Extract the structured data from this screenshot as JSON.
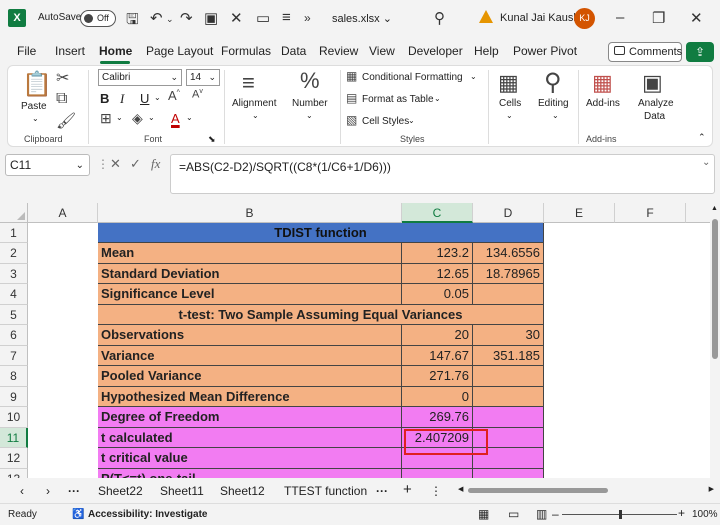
{
  "app": {
    "logo": "X",
    "autosave_label": "AutoSave",
    "autosave_state": "Off",
    "filename": "sales.xlsx",
    "filename_chevron": "⌄",
    "user_name": "Kunal Jai Kaushik",
    "user_initials": "KJ",
    "icons": [
      "save-icon",
      "undo-icon",
      "redo-icon",
      "format-painter-icon",
      "clear-icon",
      "customize-icon",
      "search-icon",
      "warning-icon",
      "minimize-icon",
      "restore-icon",
      "close-icon"
    ]
  },
  "menu": {
    "tabs": [
      "File",
      "Insert",
      "Home",
      "Page Layout",
      "Formulas",
      "Data",
      "Review",
      "View",
      "Developer",
      "Help",
      "Power Pivot"
    ],
    "active": "Home",
    "comments_label": "Comments"
  },
  "ribbon": {
    "paste_label": "Paste",
    "clipboard_label": "Clipboard",
    "font_name": "Calibri",
    "font_size": "14",
    "font_label": "Font",
    "alignment_label": "Alignment",
    "number_label": "Number",
    "conditional_formatting": "Conditional Formatting",
    "format_as_table": "Format as Table",
    "cell_styles": "Cell Styles",
    "styles_label": "Styles",
    "cells_label": "Cells",
    "editing_label": "Editing",
    "addins_label": "Add-ins",
    "analyze_label_1": "Analyze",
    "analyze_label_2": "Data",
    "addins_group_label": "Add-ins",
    "bold": "B",
    "italic": "I",
    "underline": "U",
    "font_color": "A",
    "percent_icon": "%",
    "fx": "fx"
  },
  "formula_bar": {
    "name_box": "C11",
    "formula": "=ABS(C2-D2)/SQRT((C8*(1/C6+1/D6)))"
  },
  "grid": {
    "columns": [
      "A",
      "B",
      "C",
      "D",
      "E",
      "F"
    ],
    "rows": [
      "1",
      "2",
      "3",
      "4",
      "5",
      "6",
      "7",
      "8",
      "9",
      "10",
      "11",
      "12",
      "13"
    ],
    "selected_column": "C",
    "selected_row": "11",
    "cells": {
      "title": "TDIST function",
      "b2": "Mean",
      "c2": "123.2",
      "d2": "134.6556",
      "b3": "Standard Deviation",
      "c3": "12.65",
      "d3": "18.78965",
      "b4": "Significance Level",
      "c4": "0.05",
      "ttest": "t-test: Two Sample Assuming Equal Variances",
      "b6": "Observations",
      "c6": "20",
      "d6": "30",
      "b7": "Variance",
      "c7": "147.67",
      "d7": "351.185",
      "b8": "Pooled Variance",
      "c8": "271.76",
      "b9": "Hypothesized Mean Difference",
      "c9": "0",
      "b10": "Degree of Freedom",
      "c10": "269.76",
      "b11": "t calculated",
      "c11": "2.407209",
      "b12": "t critical value",
      "b13": "P(T<=t) one-tail"
    },
    "colors": {
      "header_blue": "#4472c4",
      "orange": "#f4b183",
      "pink": "#f27cf2",
      "selection": "#e02020"
    }
  },
  "sheets": {
    "tabs": [
      "Sheet22",
      "Sheet11",
      "Sheet12",
      "TTEST function"
    ],
    "active": "TTEST function"
  },
  "status": {
    "ready": "Ready",
    "accessibility": "Accessibility: Investigate",
    "zoom": "100%"
  }
}
